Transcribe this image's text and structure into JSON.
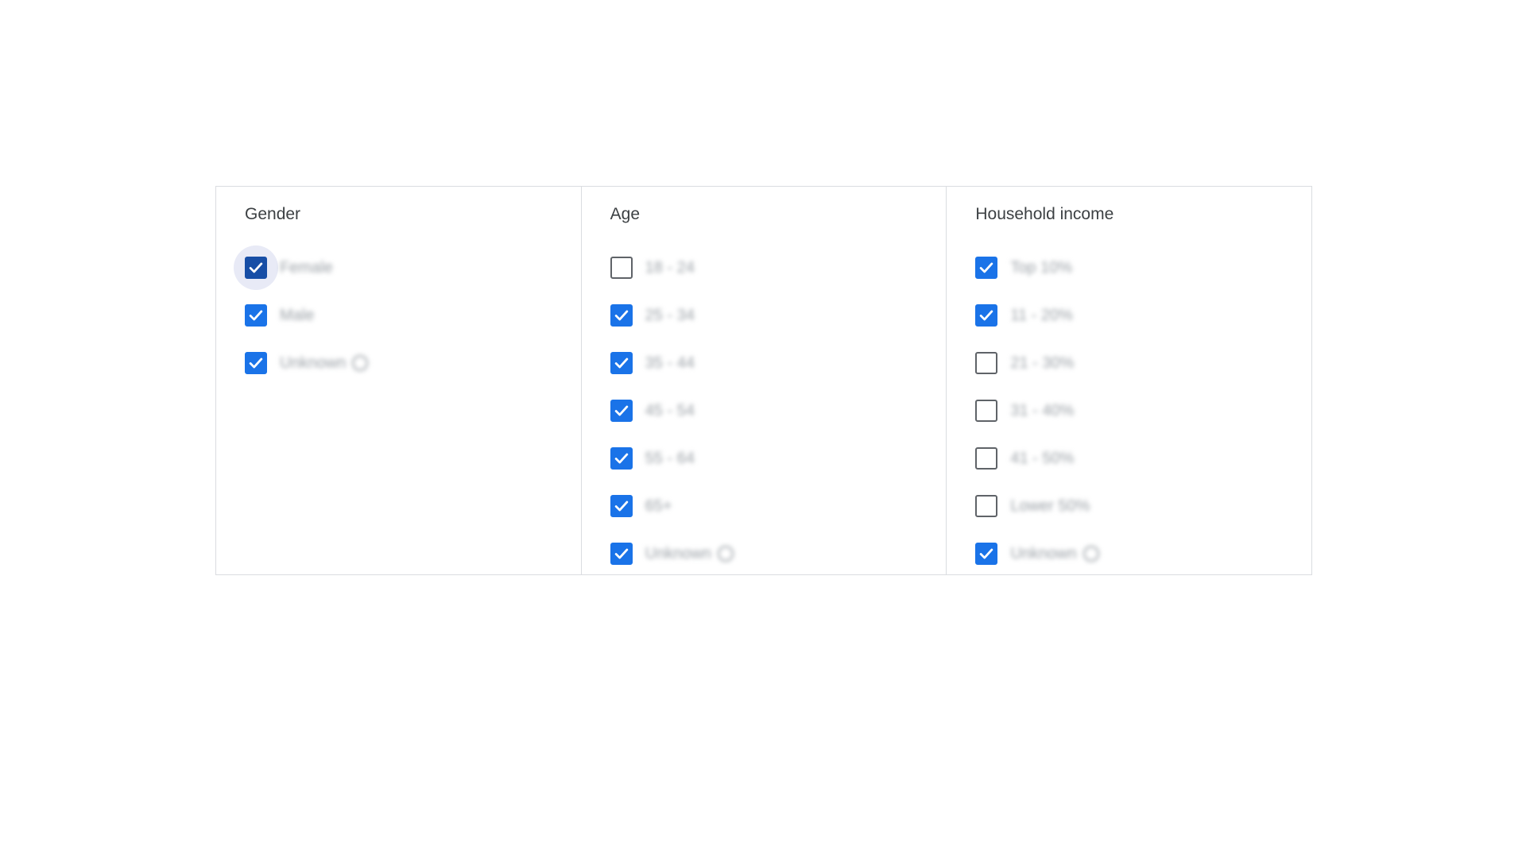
{
  "panel": {
    "columns": [
      {
        "title": "Gender",
        "options": [
          {
            "label": "Female",
            "checked": true,
            "focused": true,
            "help": false
          },
          {
            "label": "Male",
            "checked": true,
            "focused": false,
            "help": false
          },
          {
            "label": "Unknown",
            "checked": true,
            "focused": false,
            "help": true
          }
        ]
      },
      {
        "title": "Age",
        "options": [
          {
            "label": "18 - 24",
            "checked": false,
            "focused": false,
            "help": false
          },
          {
            "label": "25 - 34",
            "checked": true,
            "focused": false,
            "help": false
          },
          {
            "label": "35 - 44",
            "checked": true,
            "focused": false,
            "help": false
          },
          {
            "label": "45 - 54",
            "checked": true,
            "focused": false,
            "help": false
          },
          {
            "label": "55 - 64",
            "checked": true,
            "focused": false,
            "help": false
          },
          {
            "label": "65+",
            "checked": true,
            "focused": false,
            "help": false
          },
          {
            "label": "Unknown",
            "checked": true,
            "focused": false,
            "help": true
          }
        ]
      },
      {
        "title": "Household income",
        "options": [
          {
            "label": "Top 10%",
            "checked": true,
            "focused": false,
            "help": false
          },
          {
            "label": "11 - 20%",
            "checked": true,
            "focused": false,
            "help": false
          },
          {
            "label": "21 - 30%",
            "checked": false,
            "focused": false,
            "help": false
          },
          {
            "label": "31 - 40%",
            "checked": false,
            "focused": false,
            "help": false
          },
          {
            "label": "41 - 50%",
            "checked": false,
            "focused": false,
            "help": false
          },
          {
            "label": "Lower 50%",
            "checked": false,
            "focused": false,
            "help": false
          },
          {
            "label": "Unknown",
            "checked": true,
            "focused": false,
            "help": true
          }
        ]
      }
    ]
  },
  "colors": {
    "accent": "#1a73e8",
    "accent_focused": "#174ea6",
    "border": "#dadce0",
    "unchecked_border": "#5f6368"
  },
  "icons": {
    "checkmark": "check-icon",
    "help": "help-circle-icon"
  }
}
